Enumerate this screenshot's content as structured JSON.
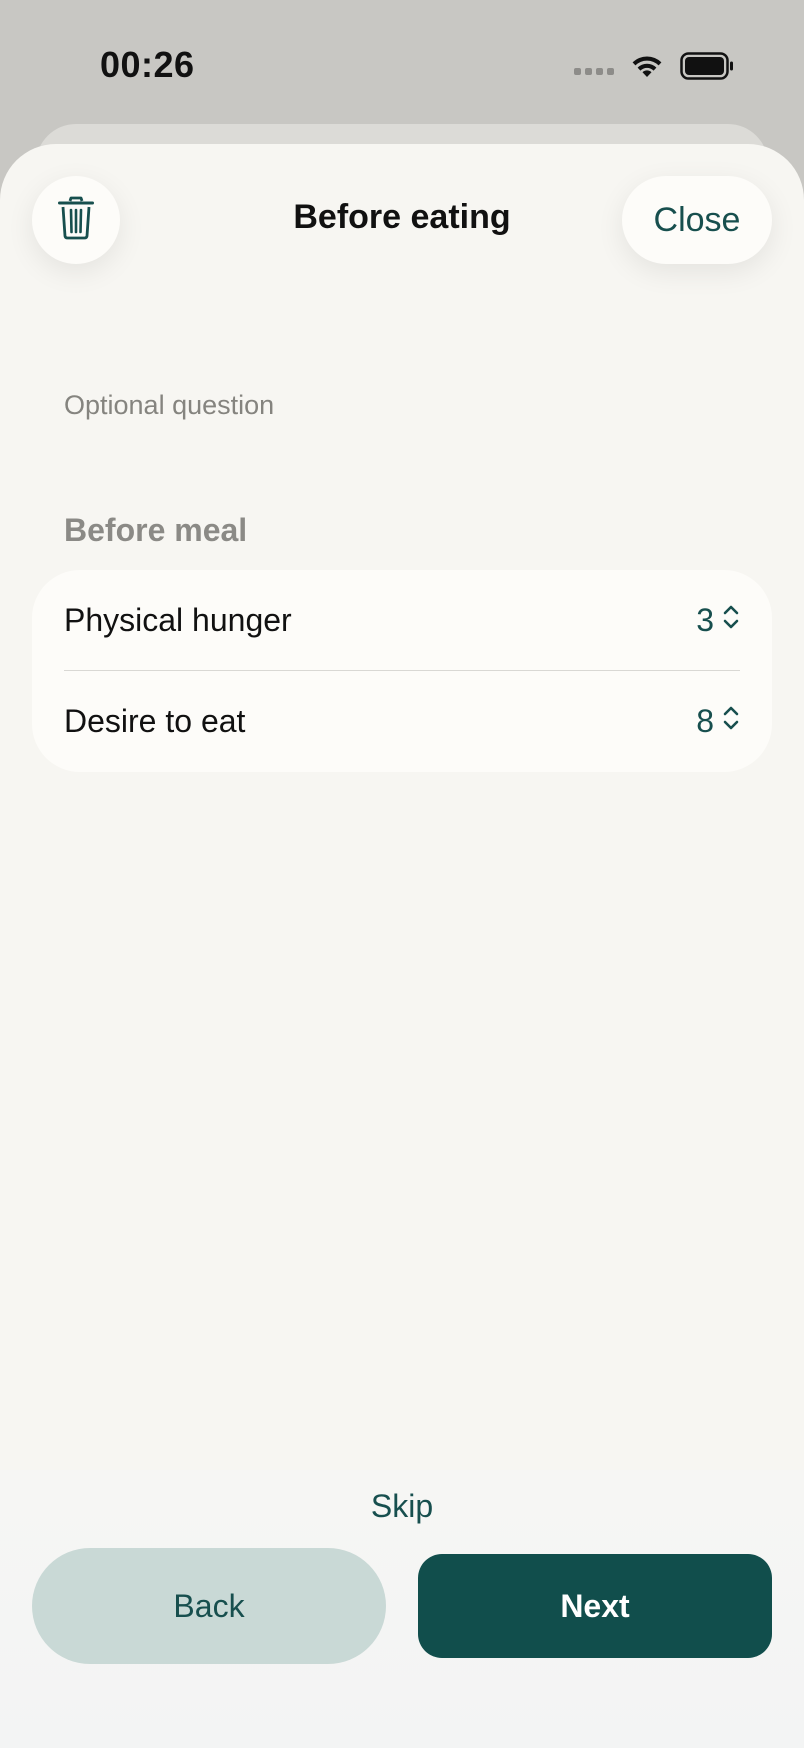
{
  "status_bar": {
    "time": "00:26",
    "icons": [
      "cellular-signal-icon",
      "wifi-icon",
      "battery-icon"
    ]
  },
  "header": {
    "title": "Before eating",
    "close_label": "Close",
    "delete_icon": "trash-icon"
  },
  "question": {
    "optional_label": "Optional question",
    "section_title": "Before meal",
    "rows": [
      {
        "label": "Physical hunger",
        "value": "3",
        "icon": "chevron-up-down-icon"
      },
      {
        "label": "Desire to eat",
        "value": "8",
        "icon": "chevron-up-down-icon"
      }
    ]
  },
  "footer": {
    "skip_label": "Skip",
    "back_label": "Back",
    "next_label": "Next"
  },
  "colors": {
    "accent": "#114e4c",
    "accent_text": "#174f4e",
    "secondary_button": "#c9d9d6",
    "sheet_background": "#f7f6f2",
    "card_background": "#fdfcf9"
  }
}
